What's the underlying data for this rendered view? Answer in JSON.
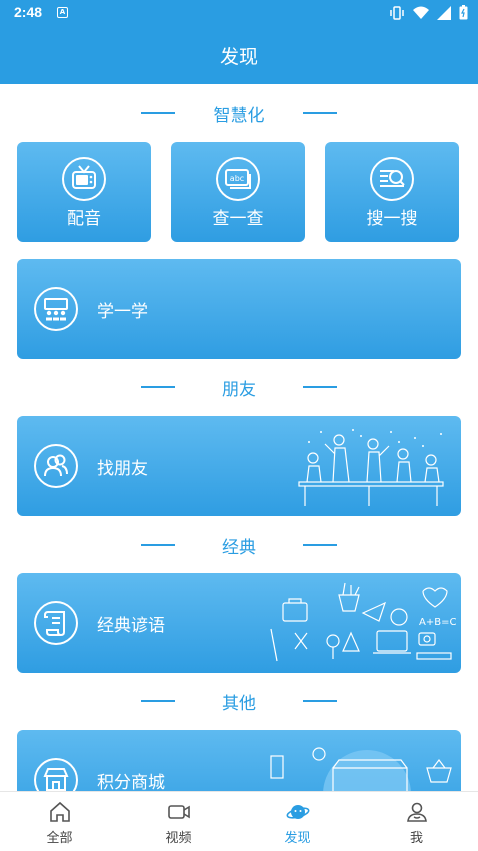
{
  "status_bar": {
    "time": "2:48",
    "badge": "A"
  },
  "header": {
    "title": "发现"
  },
  "sections": {
    "smart": "智慧化",
    "friends": "朋友",
    "classic": "经典",
    "other": "其他"
  },
  "smart_cards": [
    {
      "label": "配音",
      "icon": "tv-icon"
    },
    {
      "label": "查一查",
      "icon": "abc-dictionary-icon"
    },
    {
      "label": "搜一搜",
      "icon": "search-list-icon"
    }
  ],
  "learn_card": {
    "label": "学一学",
    "icon": "classroom-icon"
  },
  "friend_card": {
    "label": "找朋友",
    "icon": "people-icon"
  },
  "idiom_card": {
    "label": "经典谚语",
    "icon": "scroll-icon"
  },
  "mall_card": {
    "label": "积分商城",
    "icon": "shop-icon"
  },
  "tabs": [
    {
      "label": "全部",
      "icon": "home-icon"
    },
    {
      "label": "视频",
      "icon": "video-camera-icon"
    },
    {
      "label": "发现",
      "icon": "planet-icon",
      "active": true
    },
    {
      "label": "我",
      "icon": "user-icon"
    }
  ],
  "colors": {
    "primary": "#2a9de2",
    "card_top": "#5ebaf0",
    "card_bottom": "#2f9de2"
  }
}
